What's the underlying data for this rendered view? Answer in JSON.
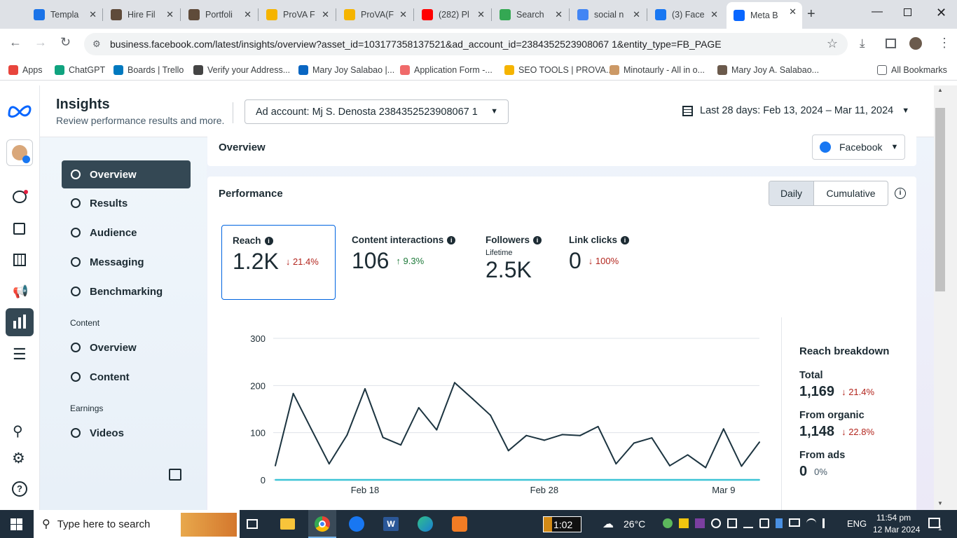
{
  "browser": {
    "tabs": [
      {
        "title": "Templa",
        "color": "#1a73e8"
      },
      {
        "title": "Hire Fil",
        "color": "#5f4b3a"
      },
      {
        "title": "Portfoli",
        "color": "#5f4b3a"
      },
      {
        "title": "ProVA F",
        "color": "#f5b400"
      },
      {
        "title": "ProVA(F",
        "color": "#f5b400"
      },
      {
        "title": "(282) Pl",
        "color": "#ff0000"
      },
      {
        "title": "Search",
        "color": "#34a853"
      },
      {
        "title": "social n",
        "color": "#4285f4"
      },
      {
        "title": "(3) Face",
        "color": "#1877f2"
      },
      {
        "title": "Meta B",
        "color": "#0866ff"
      }
    ],
    "url": "business.facebook.com/latest/insights/overview?asset_id=103177358137521&ad_account_id=2384352523908067 1&entity_type=FB_PAGE",
    "bookmarks": [
      "Apps",
      "ChatGPT",
      "Boards | Trello",
      "Verify your Address...",
      "Mary Joy Salabao |...",
      "Application Form -...",
      "SEO TOOLS | PROVA...",
      "Minotaurly - All in o...",
      "Mary Joy A. Salabao..."
    ],
    "all_bookmarks": "All Bookmarks"
  },
  "header": {
    "title": "Insights",
    "subtitle": "Review performance results and more.",
    "ad_account": "Ad account: Mj S. Denosta 2384352523908067 1",
    "date_range": "Last 28 days: Feb 13, 2024 – Mar 11, 2024"
  },
  "sidebar": {
    "items": [
      {
        "label": "Overview",
        "icon": "overview-icon"
      },
      {
        "label": "Results",
        "icon": "results-icon"
      },
      {
        "label": "Audience",
        "icon": "audience-icon"
      },
      {
        "label": "Messaging",
        "icon": "messaging-icon"
      },
      {
        "label": "Benchmarking",
        "icon": "benchmarking-icon"
      }
    ],
    "content_head": "Content",
    "content_items": [
      {
        "label": "Overview",
        "icon": "content-overview-icon"
      },
      {
        "label": "Content",
        "icon": "content-table-icon"
      }
    ],
    "earnings_head": "Earnings",
    "earnings_items": [
      {
        "label": "Videos",
        "icon": "dollar-icon"
      }
    ]
  },
  "overview": {
    "title": "Overview",
    "platform": "Facebook"
  },
  "performance": {
    "title": "Performance",
    "toggle": [
      "Daily",
      "Cumulative"
    ],
    "metrics": [
      {
        "label": "Reach",
        "value": "1.2K",
        "change": "21.4%",
        "dir": "down",
        "sub": ""
      },
      {
        "label": "Content interactions",
        "value": "106",
        "change": "9.3%",
        "dir": "up",
        "sub": ""
      },
      {
        "label": "Followers",
        "value": "2.5K",
        "change": "",
        "dir": "",
        "sub": "Lifetime"
      },
      {
        "label": "Link clicks",
        "value": "0",
        "change": "100%",
        "dir": "down",
        "sub": ""
      }
    ],
    "breakdown": {
      "title": "Reach breakdown",
      "rows": [
        {
          "label": "Total",
          "value": "1,169",
          "change": "21.4%"
        },
        {
          "label": "From organic",
          "value": "1,148",
          "change": "22.8%"
        },
        {
          "label": "From ads",
          "value": "0",
          "change": "0%"
        }
      ]
    }
  },
  "chart_data": {
    "type": "line",
    "x": [
      "Feb 13",
      "Feb 14",
      "Feb 15",
      "Feb 16",
      "Feb 17",
      "Feb 18",
      "Feb 19",
      "Feb 20",
      "Feb 21",
      "Feb 22",
      "Feb 23",
      "Feb 24",
      "Feb 25",
      "Feb 26",
      "Feb 27",
      "Feb 28",
      "Feb 29",
      "Mar 1",
      "Mar 2",
      "Mar 3",
      "Mar 4",
      "Mar 5",
      "Mar 6",
      "Mar 7",
      "Mar 8",
      "Mar 9",
      "Mar 10",
      "Mar 11"
    ],
    "xticks": [
      "Feb 18",
      "Feb 28",
      "Mar 9"
    ],
    "yticks": [
      "0",
      "100",
      "200",
      "300"
    ],
    "ylim": [
      0,
      300
    ],
    "series": [
      {
        "values": [
          30,
          183,
          108,
          34,
          95,
          193,
          90,
          74,
          153,
          106,
          206,
          172,
          137,
          62,
          94,
          84,
          96,
          94,
          113,
          34,
          78,
          89,
          30,
          53,
          26,
          108,
          29,
          80
        ],
        "color": "#1c3440"
      },
      {
        "values": [
          0,
          0,
          0,
          0,
          0,
          0,
          0,
          0,
          0,
          0,
          0,
          0,
          0,
          0,
          0,
          0,
          0,
          0,
          0,
          0,
          0,
          0,
          0,
          0,
          0,
          0,
          0,
          0
        ],
        "color": "#3ec4d6"
      }
    ]
  },
  "taskbar": {
    "search": "Type here to search",
    "timer": "1:02",
    "temp": "26°C",
    "lang": "ENG",
    "time": "11:54 pm",
    "date": "12 Mar 2024",
    "notif": "1"
  }
}
